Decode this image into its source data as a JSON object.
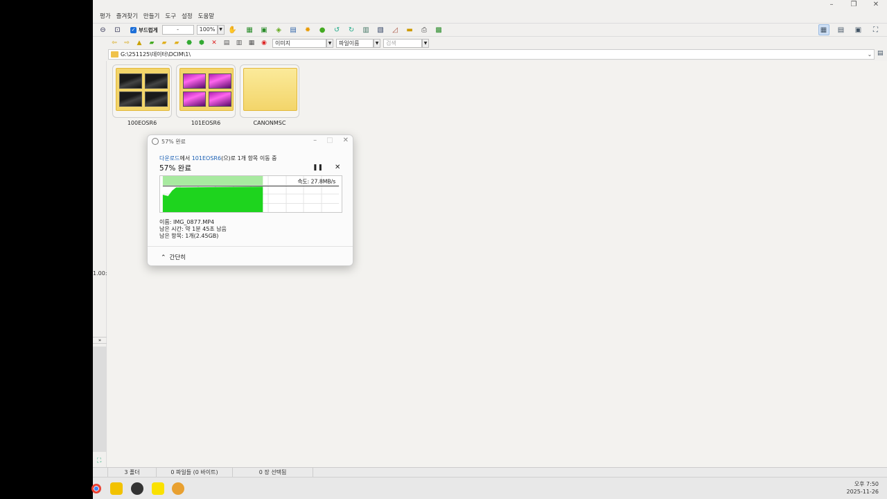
{
  "menu": [
    "평가",
    "즐겨찾기",
    "만들기",
    "도구",
    "설정",
    "도움말"
  ],
  "toolbar": {
    "checkbox_label": "부드럽게",
    "field_value": "-",
    "zoom_value": "100%"
  },
  "toolbar2": {
    "type_select": "이미지",
    "sort_select": "파일이름",
    "search_placeholder": "검색"
  },
  "address": {
    "path": "G:\\251125\\데이터\\DCIM\\1\\"
  },
  "left_pane": {
    "partial_text": "1.00:"
  },
  "folders": [
    {
      "name": "100EOSR6",
      "style": "dark"
    },
    {
      "name": "101EOSR6",
      "style": "magenta"
    },
    {
      "name": "CANONMSC",
      "style": "plain"
    }
  ],
  "status": {
    "folders": "3 폴더",
    "files": "0 파일들 (0 바이트)",
    "selected": "0 장 선택됨"
  },
  "tray": {
    "time": "오후 7:50",
    "date": "2025-11-26"
  },
  "dialog": {
    "title": "57% 완료",
    "from": "다운로드",
    "from_suffix": "에서 ",
    "to": "101EOSR6",
    "to_suffix": "(으)로 1개 항목 이동 중",
    "percent_text": "57% 완료",
    "speed": "속도: 27.8MB/s",
    "progress": 0.57,
    "name_line": "이름: IMG_0877.MP4",
    "time_line": "남은 시간: 약 1분 45초 남음",
    "items_line": "남은 항목: 1개(2.45GB)",
    "brief_label": "간단히",
    "colors": {
      "fill": "#1ed41e",
      "done": "#a8eaa0",
      "link": "#1a5fb4"
    }
  }
}
